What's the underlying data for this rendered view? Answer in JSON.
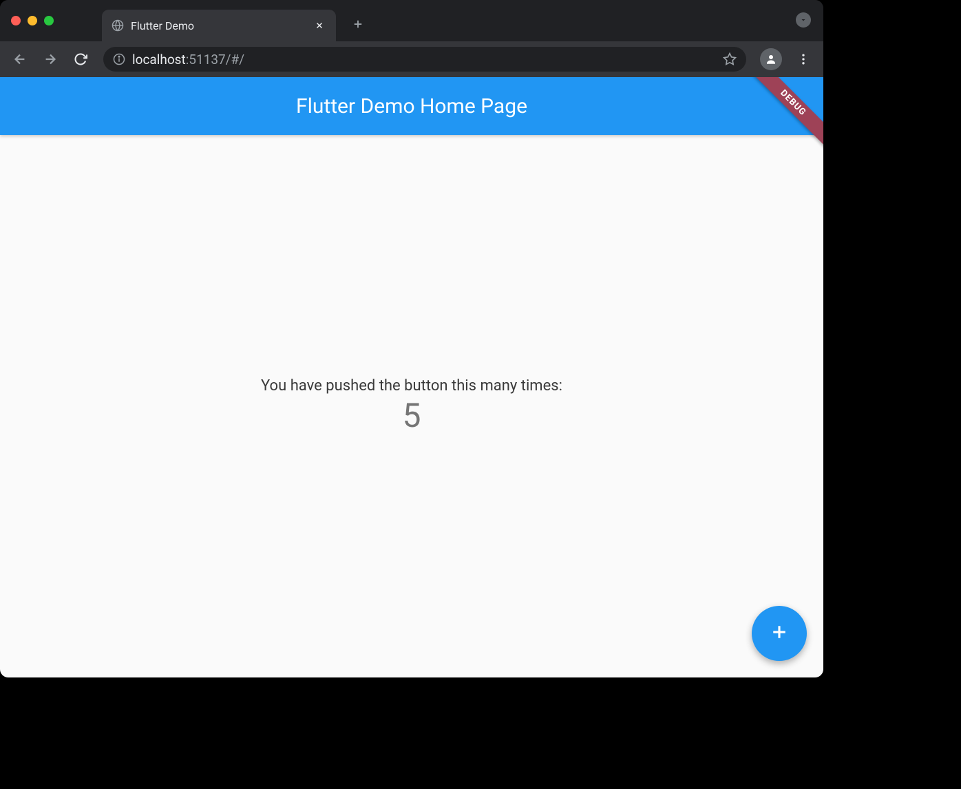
{
  "browser": {
    "tab_title": "Flutter Demo",
    "url_full": "localhost:51137/#/",
    "url_secondary": ":51137/#/",
    "url_host": "localhost"
  },
  "app": {
    "appbar_title": "Flutter Demo Home Page",
    "debug_label": "DEBUG",
    "body_text": "You have pushed the button this many times:",
    "counter_value": "5"
  },
  "colors": {
    "primary": "#2196f3",
    "background": "#fafafa",
    "ribbon": "#9e4257"
  }
}
